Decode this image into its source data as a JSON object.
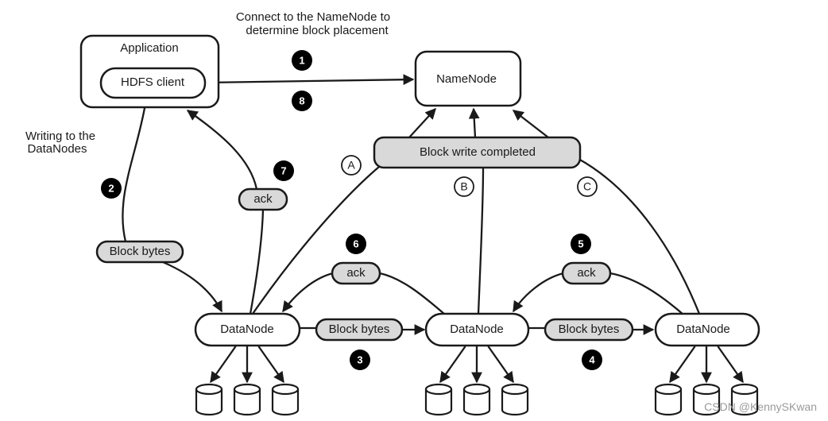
{
  "labels": {
    "connect_line1": "Connect to the NameNode to",
    "connect_line2": "determine block placement",
    "writing_line1": "Writing to the",
    "writing_line2": "DataNodes"
  },
  "nodes": {
    "application": "Application",
    "hdfs_client": "HDFS client",
    "namenode": "NameNode",
    "block_write_completed": "Block write completed",
    "datanode1": "DataNode",
    "datanode2": "DataNode",
    "datanode3": "DataNode"
  },
  "messages": {
    "block_bytes_client": "Block bytes",
    "block_bytes_dn1_dn2": "Block bytes",
    "block_bytes_dn2_dn3": "Block bytes",
    "ack_client": "ack",
    "ack_dn2_dn1": "ack",
    "ack_dn3_dn2": "ack"
  },
  "steps": [
    "1",
    "2",
    "3",
    "4",
    "5",
    "6",
    "7",
    "8"
  ],
  "letters": [
    "A",
    "B",
    "C"
  ],
  "watermark": "CSDN @KennySKwan",
  "colors": {
    "pill_fill": "#d9d9d9",
    "stroke": "#1a1a1a",
    "step_badge": "#000000"
  }
}
